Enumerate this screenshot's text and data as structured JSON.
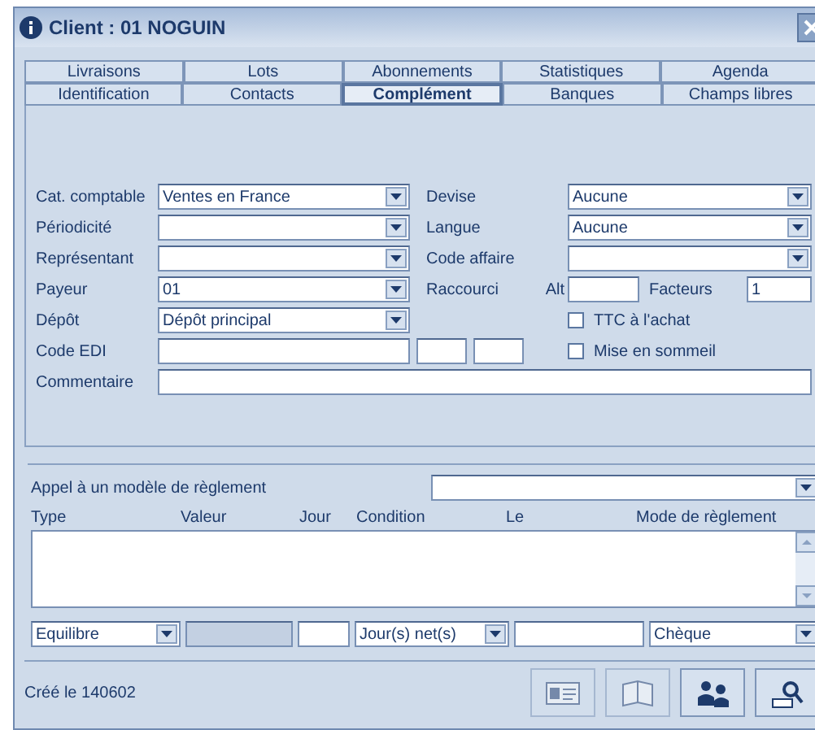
{
  "window": {
    "title": "Client : 01 NOGUIN"
  },
  "tab_rows": [
    [
      {
        "label": "Livraisons",
        "selected": false
      },
      {
        "label": "Lots",
        "selected": false
      },
      {
        "label": "Abonnements",
        "selected": false
      },
      {
        "label": "Statistiques",
        "selected": false
      },
      {
        "label": "Agenda",
        "selected": false
      }
    ],
    [
      {
        "label": "Identification",
        "selected": false
      },
      {
        "label": "Contacts",
        "selected": false
      },
      {
        "label": "Complément",
        "selected": true
      },
      {
        "label": "Banques",
        "selected": false
      },
      {
        "label": "Champs libres",
        "selected": false
      }
    ]
  ],
  "form_rows": [
    {
      "label": "Cat. comptable",
      "field": {
        "kind": "select",
        "value": "Ventes en France"
      },
      "side_label": "Devise",
      "side_field": {
        "kind": "select",
        "value": "Aucune"
      }
    },
    {
      "label": "Périodicité",
      "field": {
        "kind": "select"
      },
      "side_label": "Langue",
      "side_field": {
        "kind": "select",
        "value": "Aucune"
      }
    },
    {
      "label": "Représentant",
      "field": {
        "kind": "select"
      },
      "side_label": "Code affaire",
      "side_field": {
        "kind": "select"
      }
    },
    {
      "label": "Payeur",
      "field": {
        "kind": "select",
        "value": "01"
      },
      "side_label": "Raccourci",
      "side_field": {
        "kind": "shortcut",
        "prefix": "Alt",
        "factor_label": "Facteurs",
        "factor_value": "1"
      }
    },
    {
      "label": "Dépôt",
      "field": {
        "kind": "select",
        "value": "Dépôt principal"
      },
      "side_field": {
        "kind": "checkbox",
        "label": "TTC à l'achat",
        "checked": false
      }
    },
    {
      "label": "Code EDI",
      "field": {
        "kind": "edi"
      },
      "side_field": {
        "kind": "checkbox",
        "label": "Mise en sommeil",
        "checked": false
      }
    },
    {
      "label": "Commentaire",
      "field": {
        "kind": "wide"
      }
    }
  ],
  "payment": {
    "template_label": "Appel à un modèle de règlement",
    "columns": [
      "Type",
      "Valeur",
      "Jour",
      "Condition",
      "Le",
      "Mode de règlement"
    ],
    "editor": [
      {
        "kind": "select",
        "value": "Equilibre"
      },
      {
        "kind": "input",
        "disabled": true
      },
      {
        "kind": "input",
        "disabled": false
      },
      {
        "kind": "select",
        "value": "Jour(s) net(s)"
      },
      {
        "kind": "input",
        "disabled": false
      },
      {
        "kind": "select",
        "value": "Chèque"
      }
    ]
  },
  "footer": {
    "created": "Créé le 140602",
    "toolbar": [
      {
        "kind": "card",
        "disabled": true
      },
      {
        "kind": "book",
        "disabled": true
      },
      {
        "kind": "people",
        "disabled": false
      },
      {
        "kind": "search",
        "disabled": false
      }
    ]
  }
}
